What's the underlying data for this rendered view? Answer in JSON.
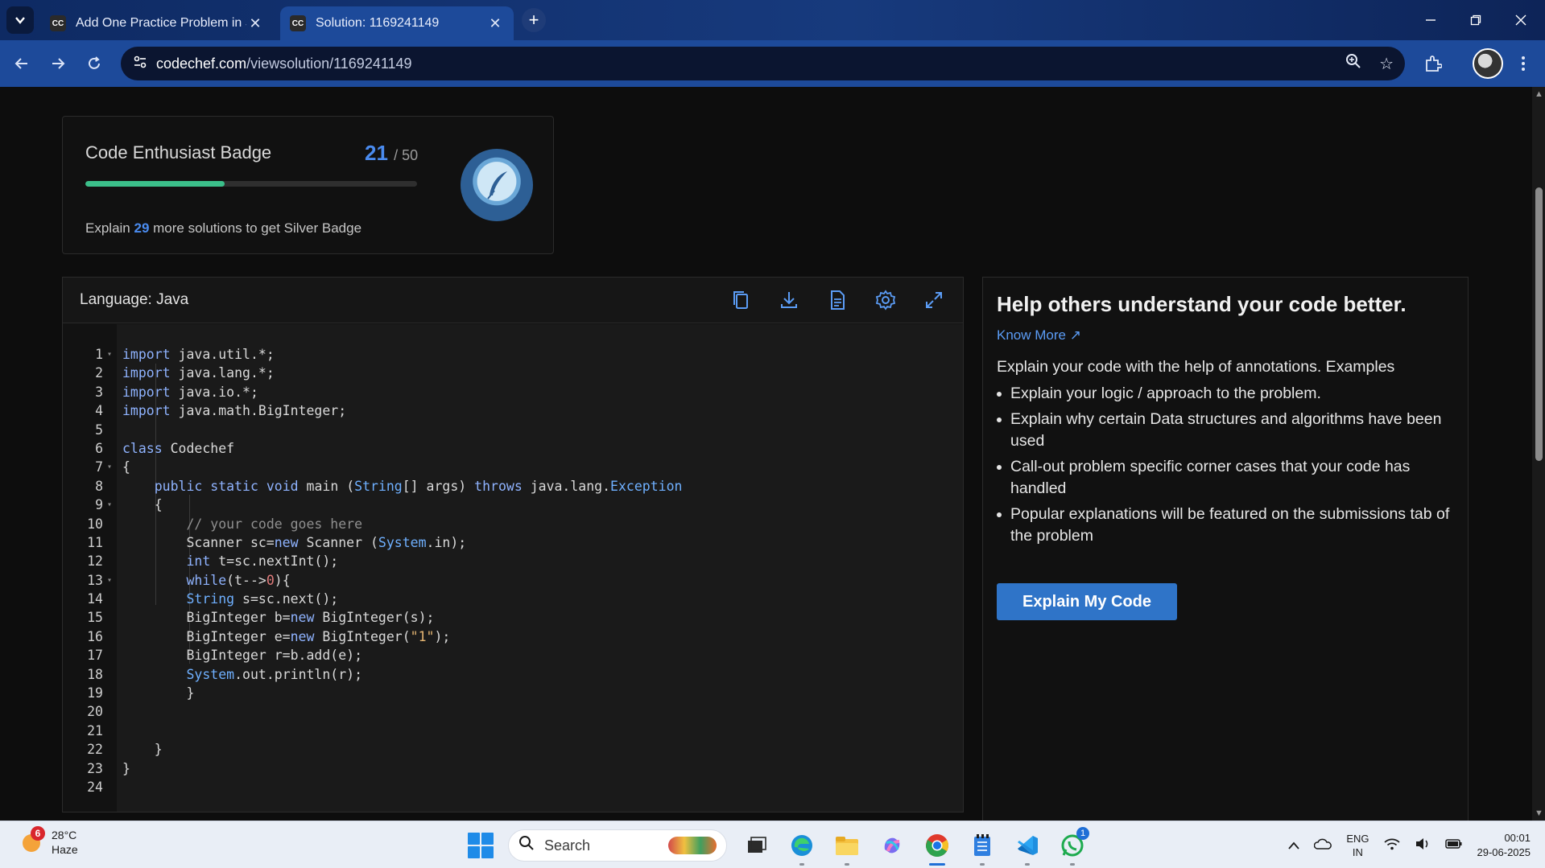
{
  "browser": {
    "tabs": [
      {
        "label": "Add One Practice Problem in St",
        "favicon": "CC",
        "active": false
      },
      {
        "label": "Solution: 1169241149",
        "favicon": "CC",
        "active": true
      }
    ],
    "url_host": "codechef.com",
    "url_path": "/viewsolution/1169241149"
  },
  "badge": {
    "title": "Code Enthusiast Badge",
    "current": "21",
    "total": "/ 50",
    "progress_fraction": 0.42,
    "desc_pre": "Explain ",
    "desc_num": "29",
    "desc_post": " more solutions to get Silver Badge"
  },
  "code_panel": {
    "language_label": "Language: Java",
    "tools": [
      "copy-icon",
      "download-icon",
      "file-icon",
      "settings-icon",
      "expand-icon"
    ]
  },
  "code_lines": [
    {
      "n": "1",
      "fold": true,
      "html": "<span class=\"kw\">import</span> java.util.*;"
    },
    {
      "n": "2",
      "html": "<span class=\"kw\">import</span> java.lang.*;"
    },
    {
      "n": "3",
      "html": "<span class=\"kw\">import</span> java.io.*;"
    },
    {
      "n": "4",
      "html": "<span class=\"kw\">import</span> java.math.BigInteger;"
    },
    {
      "n": "5",
      "html": ""
    },
    {
      "n": "6",
      "html": "<span class=\"kw\">class</span> Codechef"
    },
    {
      "n": "7",
      "fold": true,
      "html": "{"
    },
    {
      "n": "8",
      "html": "    <span class=\"kw\">public</span> <span class=\"kw\">static</span> <span class=\"kw\">void</span> main (<span class=\"ty\">String</span>[] args) <span class=\"kw\">throws</span> java.lang.<span class=\"ty\">Exception</span>"
    },
    {
      "n": "9",
      "fold": true,
      "html": "    {"
    },
    {
      "n": "10",
      "html": "        <span class=\"cm\">// your code goes here</span>"
    },
    {
      "n": "11",
      "html": "        Scanner sc=<span class=\"kw\">new</span> Scanner (<span class=\"ty\">System</span>.in);"
    },
    {
      "n": "12",
      "html": "        <span class=\"kw\">int</span> t=sc.nextInt();"
    },
    {
      "n": "13",
      "fold": true,
      "html": "        <span class=\"kw\">while</span>(t--&gt;<span class=\"nu\">0</span>){"
    },
    {
      "n": "14",
      "html": "        <span class=\"ty\">String</span> s=sc.next();"
    },
    {
      "n": "15",
      "html": "        BigInteger b=<span class=\"kw\">new</span> BigInteger(s);"
    },
    {
      "n": "16",
      "html": "        BigInteger e=<span class=\"kw\">new</span> BigInteger(<span class=\"st\">\"1\"</span>);"
    },
    {
      "n": "17",
      "html": "        BigInteger r=b.add(e);"
    },
    {
      "n": "18",
      "html": "        <span class=\"ty\">System</span>.out.println(r);"
    },
    {
      "n": "19",
      "html": "        }"
    },
    {
      "n": "20",
      "html": ""
    },
    {
      "n": "21",
      "html": ""
    },
    {
      "n": "22",
      "html": "    }"
    },
    {
      "n": "23",
      "html": "}"
    },
    {
      "n": "24",
      "html": ""
    }
  ],
  "help": {
    "heading": "Help others understand your code better.",
    "know_more": "Know More",
    "intro": "Explain your code with the help of annotations. Examples",
    "points": [
      "Explain your logic / approach to the problem.",
      "Explain why certain Data structures and algorithms have been used",
      "Call-out problem specific corner cases that your code has handled",
      "Popular explanations will be featured on the submissions tab of the problem"
    ],
    "button": "Explain My Code"
  },
  "taskbar": {
    "weather_temp": "28°C",
    "weather_desc": "Haze",
    "weather_badge": "6",
    "search_placeholder": "Search",
    "whatsapp_badge": "1",
    "lang_top": "ENG",
    "lang_bottom": "IN",
    "time": "00:01",
    "date": "29-06-2025"
  },
  "colors": {
    "accent": "#2f74c8",
    "link": "#5b9cf5",
    "progress": "#3bbf8a",
    "chrome": "#1d4a9a"
  }
}
